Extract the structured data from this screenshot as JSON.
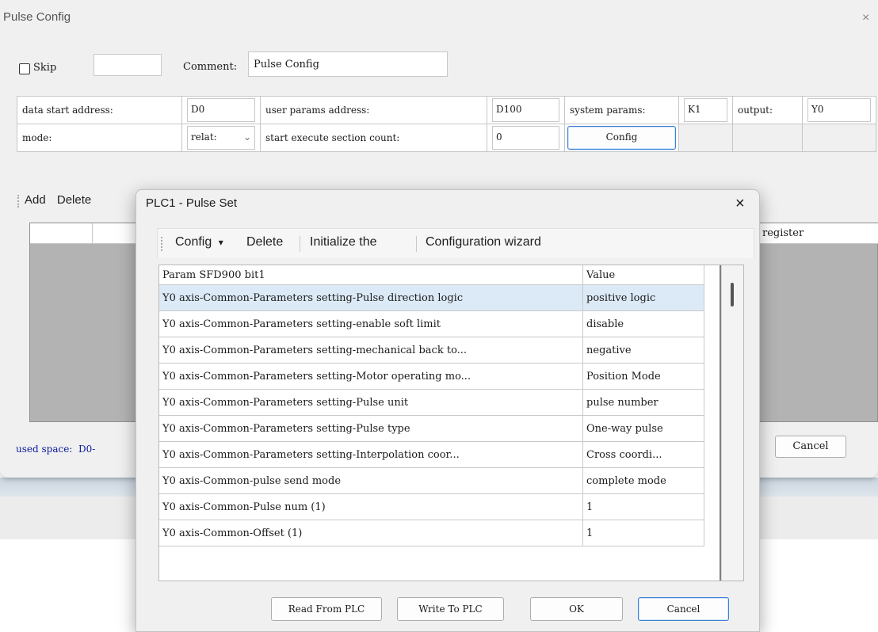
{
  "back_window": {
    "title": "Pulse Config",
    "close": "×",
    "skip_label": "Skip",
    "comment_label": "Comment:",
    "comment_value": "Pulse Config",
    "params": {
      "data_start_label": "data start address:",
      "data_start_value": "D0",
      "user_params_label": "user params address:",
      "user_params_value": "D100",
      "system_params_label": "system params:",
      "system_params_value": "K1",
      "output_label": "output:",
      "output_value": "Y0",
      "mode_label": "mode:",
      "mode_value": "relat:",
      "start_exec_label": "start execute section count:",
      "start_exec_value": "0",
      "config_button": "Config"
    },
    "toolbar": {
      "add": "Add",
      "delete": "Delete"
    },
    "grid_header_register": "register",
    "used_space_label": "used space:",
    "used_space_value": "D0-",
    "cancel_button": "Cancel"
  },
  "dialog": {
    "title": "PLC1 - Pulse  Set",
    "close": "×",
    "toolbar": {
      "config": "Config",
      "config_arrow": "▾",
      "delete": "Delete",
      "initialize": "Initialize the",
      "wizard": "Configuration wizard"
    },
    "columns": {
      "param": "Param SFD900 bit1",
      "value": "Value"
    },
    "rows": [
      {
        "param": "Y0 axis-Common-Parameters setting-Pulse direction logic",
        "value": "positive logic"
      },
      {
        "param": "Y0 axis-Common-Parameters setting-enable soft limit",
        "value": "disable"
      },
      {
        "param": "Y0 axis-Common-Parameters setting-mechanical back to...",
        "value": "negative"
      },
      {
        "param": "Y0 axis-Common-Parameters setting-Motor operating mo...",
        "value": "Position Mode"
      },
      {
        "param": "Y0 axis-Common-Parameters setting-Pulse unit",
        "value": "pulse number"
      },
      {
        "param": "Y0 axis-Common-Parameters setting-Pulse type",
        "value": "One-way pulse"
      },
      {
        "param": "Y0 axis-Common-Parameters setting-Interpolation coor...",
        "value": "Cross coordi..."
      },
      {
        "param": "Y0 axis-Common-pulse send mode",
        "value": "complete mode"
      },
      {
        "param": "Y0 axis-Common-Pulse num (1)",
        "value": "1"
      },
      {
        "param": "Y0 axis-Common-Offset (1)",
        "value": "1"
      }
    ],
    "buttons": {
      "read": "Read From PLC",
      "write": "Write To PLC",
      "ok": "OK",
      "cancel": "Cancel"
    }
  }
}
